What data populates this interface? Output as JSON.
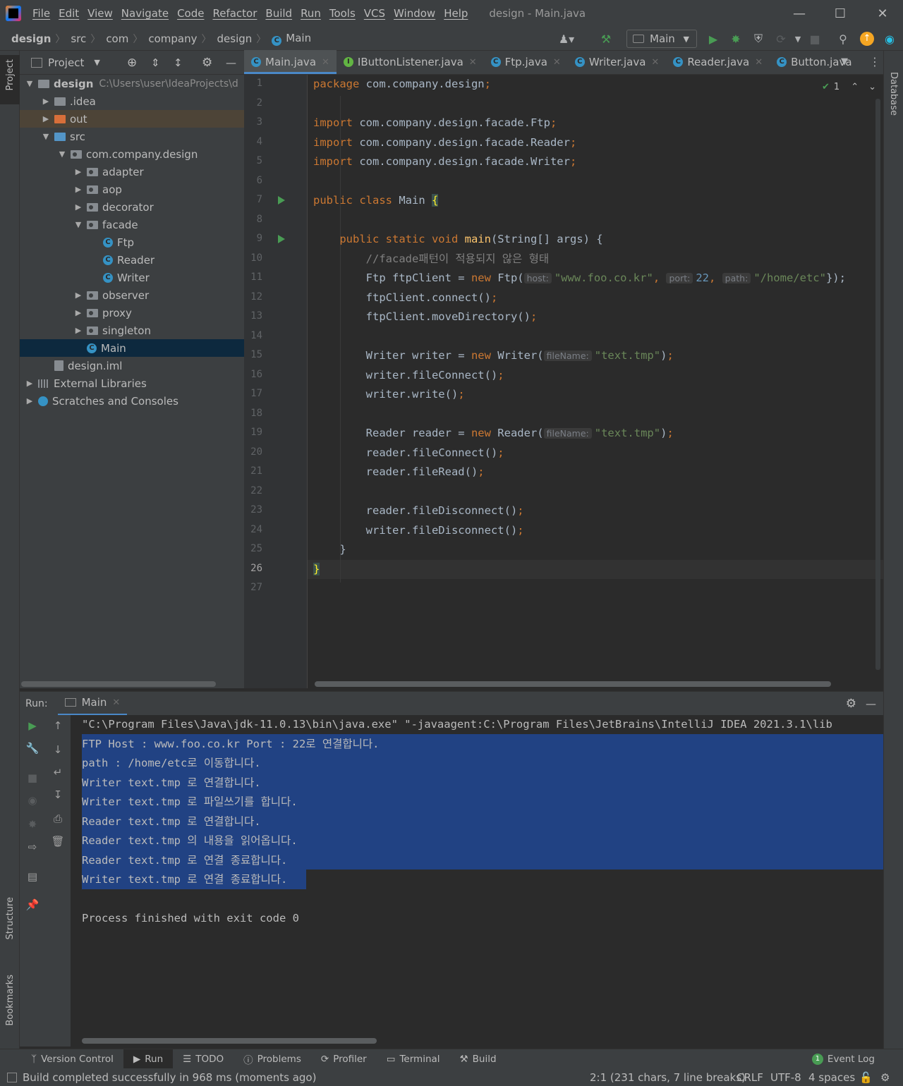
{
  "menubar": {
    "items": [
      "File",
      "Edit",
      "View",
      "Navigate",
      "Code",
      "Refactor",
      "Build",
      "Run",
      "Tools",
      "VCS",
      "Window",
      "Help"
    ],
    "window_title": "design - Main.java"
  },
  "breadcrumb": [
    "design",
    "src",
    "com",
    "company",
    "design",
    "Main"
  ],
  "toolbar": {
    "run_config": "Main"
  },
  "project_panel": {
    "title": "Project",
    "root_name": "design",
    "root_path": "C:\\Users\\user\\IdeaProjects\\d",
    "tree": [
      {
        "label": ".idea",
        "depth": 1,
        "icon": "folder",
        "arrow": ">"
      },
      {
        "label": "out",
        "depth": 1,
        "icon": "folder-orange",
        "arrow": ">"
      },
      {
        "label": "src",
        "depth": 1,
        "icon": "folder-blue",
        "arrow": "v"
      },
      {
        "label": "com.company.design",
        "depth": 2,
        "icon": "package",
        "arrow": "v"
      },
      {
        "label": "adapter",
        "depth": 3,
        "icon": "package",
        "arrow": ">"
      },
      {
        "label": "aop",
        "depth": 3,
        "icon": "package",
        "arrow": ">"
      },
      {
        "label": "decorator",
        "depth": 3,
        "icon": "package",
        "arrow": ">"
      },
      {
        "label": "facade",
        "depth": 3,
        "icon": "package",
        "arrow": "v"
      },
      {
        "label": "Ftp",
        "depth": 4,
        "icon": "class",
        "arrow": ""
      },
      {
        "label": "Reader",
        "depth": 4,
        "icon": "class",
        "arrow": ""
      },
      {
        "label": "Writer",
        "depth": 4,
        "icon": "class",
        "arrow": ""
      },
      {
        "label": "observer",
        "depth": 3,
        "icon": "package",
        "arrow": ">"
      },
      {
        "label": "proxy",
        "depth": 3,
        "icon": "package",
        "arrow": ">"
      },
      {
        "label": "singleton",
        "depth": 3,
        "icon": "package",
        "arrow": ">"
      },
      {
        "label": "Main",
        "depth": 3,
        "icon": "class",
        "arrow": "",
        "selected": true
      },
      {
        "label": "design.iml",
        "depth": 1,
        "icon": "file",
        "arrow": ""
      },
      {
        "label": "External Libraries",
        "depth": 0,
        "icon": "library",
        "arrow": ">"
      },
      {
        "label": "Scratches and Consoles",
        "depth": 0,
        "icon": "scratch",
        "arrow": ">"
      }
    ]
  },
  "editor_tabs": [
    {
      "label": "Main.java",
      "icon": "class",
      "active": true
    },
    {
      "label": "IButtonListener.java",
      "icon": "interface"
    },
    {
      "label": "Ftp.java",
      "icon": "class"
    },
    {
      "label": "Writer.java",
      "icon": "class"
    },
    {
      "label": "Reader.java",
      "icon": "class"
    },
    {
      "label": "Button.java",
      "icon": "class"
    }
  ],
  "inspection": {
    "count": "1"
  },
  "editor": {
    "current_line": 26,
    "lines": [
      [
        [
          "kw",
          "package "
        ],
        [
          "",
          "com.company.design"
        ],
        [
          "kw",
          ";"
        ]
      ],
      [],
      [
        [
          "kw",
          "import "
        ],
        [
          "",
          "com.company.design.facade.Ftp"
        ],
        [
          "kw",
          ";"
        ]
      ],
      [
        [
          "kw",
          "import "
        ],
        [
          "",
          "com.company.design.facade.Reader"
        ],
        [
          "kw",
          ";"
        ]
      ],
      [
        [
          "kw",
          "import "
        ],
        [
          "",
          "com.company.design.facade.Writer"
        ],
        [
          "kw",
          ";"
        ]
      ],
      [],
      [
        [
          "kw",
          "public class "
        ],
        [
          "",
          "Main "
        ],
        [
          "brace",
          "{"
        ]
      ],
      [],
      [
        [
          "",
          "    "
        ],
        [
          "kw",
          "public static void "
        ],
        [
          "fn",
          "main"
        ],
        [
          "",
          "(String[] args) {"
        ]
      ],
      [
        [
          "",
          "        "
        ],
        [
          "cm",
          "//facade패턴이 적용되지 않은 형태"
        ]
      ],
      [
        [
          "",
          "        Ftp ftpClient = "
        ],
        [
          "kw",
          "new "
        ],
        [
          "",
          "Ftp("
        ],
        [
          "hint",
          "host:"
        ],
        [
          "str",
          "\"www.foo.co.kr\""
        ],
        [
          "kw",
          ", "
        ],
        [
          "hint",
          "port:"
        ],
        [
          "num",
          "22"
        ],
        [
          "kw",
          ", "
        ],
        [
          "hint",
          "path:"
        ],
        [
          "str",
          "\"/home/etc\""
        ],
        [
          "",
          "});"
        ]
      ],
      [
        [
          "",
          "        ftpClient.connect()"
        ],
        [
          "kw",
          ";"
        ]
      ],
      [
        [
          "",
          "        ftpClient.moveDirectory()"
        ],
        [
          "kw",
          ";"
        ]
      ],
      [],
      [
        [
          "",
          "        Writer writer = "
        ],
        [
          "kw",
          "new "
        ],
        [
          "",
          "Writer("
        ],
        [
          "hint",
          "fileName:"
        ],
        [
          "str",
          "\"text.tmp\""
        ],
        [
          "",
          ")"
        ],
        [
          "kw",
          ";"
        ]
      ],
      [
        [
          "",
          "        writer.fileConnect()"
        ],
        [
          "kw",
          ";"
        ]
      ],
      [
        [
          "",
          "        writer.write()"
        ],
        [
          "kw",
          ";"
        ]
      ],
      [],
      [
        [
          "",
          "        Reader reader = "
        ],
        [
          "kw",
          "new "
        ],
        [
          "",
          "Reader("
        ],
        [
          "hint",
          "fileName:"
        ],
        [
          "str",
          "\"text.tmp\""
        ],
        [
          "",
          ")"
        ],
        [
          "kw",
          ";"
        ]
      ],
      [
        [
          "",
          "        reader.fileConnect()"
        ],
        [
          "kw",
          ";"
        ]
      ],
      [
        [
          "",
          "        reader.fileRead()"
        ],
        [
          "kw",
          ";"
        ]
      ],
      [],
      [
        [
          "",
          "        reader.fileDisconnect()"
        ],
        [
          "kw",
          ";"
        ]
      ],
      [
        [
          "",
          "        writer.fileDisconnect()"
        ],
        [
          "kw",
          ";"
        ]
      ],
      [
        [
          "",
          "    }"
        ]
      ],
      [
        [
          "brace",
          "}"
        ]
      ],
      []
    ]
  },
  "run_panel": {
    "label": "Run:",
    "tab": "Main",
    "command": "\"C:\\Program Files\\Java\\jdk-11.0.13\\bin\\java.exe\" \"-javaagent:C:\\Program Files\\JetBrains\\IntelliJ IDEA 2021.3.1\\lib",
    "output": [
      "FTP Host : www.foo.co.kr Port : 22로 연결합니다.",
      "path : /home/etc로 이동합니다.",
      "Writer text.tmp 로 연결합니다.",
      "Writer text.tmp 로 파일쓰기를 합니다.",
      "Reader text.tmp 로 연결합니다.",
      "Reader text.tmp 의 내용을 읽어옵니다.",
      "Reader text.tmp 로 연결 종료합니다.",
      "Writer text.tmp 로 연결 종료합니다."
    ],
    "exit": "Process finished with exit code 0"
  },
  "bottom_tools": [
    "Version Control",
    "Run",
    "TODO",
    "Problems",
    "Profiler",
    "Terminal",
    "Build"
  ],
  "event_log": {
    "count": "1",
    "label": "Event Log"
  },
  "status": {
    "message": "Build completed successfully in 968 ms (moments ago)",
    "position": "2:1 (231 chars, 7 line breaks)",
    "line_sep": "CRLF",
    "encoding": "UTF-8",
    "indent": "4 spaces"
  },
  "side_labels": {
    "project": "Project",
    "structure": "Structure",
    "bookmarks": "Bookmarks",
    "database": "Database"
  },
  "colors": {
    "keyword": "#cc7832",
    "string": "#6a8759",
    "comment": "#808080",
    "selection": "#214283",
    "accent": "#4a88c7"
  }
}
